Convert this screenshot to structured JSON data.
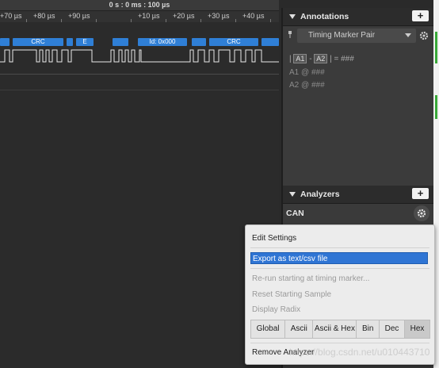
{
  "timeline": {
    "header": "0 s : 0 ms : 100 µs",
    "ticks": [
      "+70 µs",
      "+80 µs",
      "+90 µs",
      "+10 µs",
      "+20 µs",
      "+30 µs",
      "+40 µs"
    ]
  },
  "decode": {
    "frames": [
      "CRC",
      "E",
      "Id: 0x000",
      "CRC"
    ]
  },
  "annotations": {
    "title": "Annotations",
    "add_label": "+",
    "marker_pair": "Timing Marker Pair",
    "measurement_line": {
      "a1": "A1",
      "a2": "A2",
      "value": "= ###"
    },
    "a1_line": "A1  @  ###",
    "a2_line": "A2  @  ###"
  },
  "analyzers": {
    "title": "Analyzers",
    "add_label": "+",
    "items": [
      {
        "name": "CAN"
      }
    ]
  },
  "context_menu": {
    "edit_settings": "Edit Settings",
    "export": "Export as text/csv file",
    "rerun": "Re-run starting at timing marker...",
    "reset": "Reset Starting Sample",
    "display_radix": "Display Radix",
    "radix_options": [
      "Global",
      "Ascii",
      "Ascii & Hex",
      "Bin",
      "Dec",
      "Hex"
    ],
    "radix_selected": "Hex",
    "remove": "Remove Analyzer"
  },
  "watermark": "https://blog.csdn.net/u010443710",
  "colors": {
    "frame_blue": "#2f7fd6",
    "menu_highlight": "#2f75d4"
  }
}
